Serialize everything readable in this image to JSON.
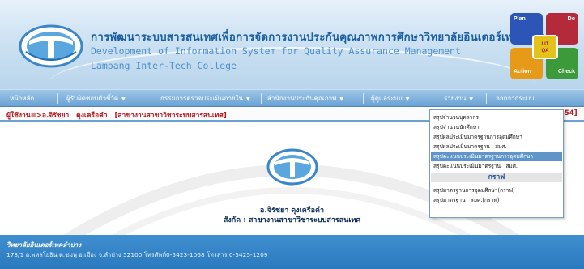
{
  "header": {
    "title_th": "การพัฒนาระบบสารสนเทศเพื่อการจัดการงานประกันคุณภาพการศึกษาวิทยาลัยอินเตอร์เทคลำปาง",
    "title_en": "Development of Information System for Quality Assurance Management",
    "college_en": "Lampang Inter-Tech College",
    "pdca": {
      "plan": "Plan",
      "do": "Do",
      "action": "Action",
      "check": "Check",
      "center_top": "LIT",
      "center_bottom": "QA"
    }
  },
  "menu": [
    {
      "label": "หน้าหลัก",
      "has_arrow": false
    },
    {
      "label": "ผู้รับผิดชอบตัวชี้วัด",
      "has_arrow": true
    },
    {
      "label": "กรรมการตรวจประเมินภายใน",
      "has_arrow": true
    },
    {
      "label": "สำนักงานประกันคุณภาพ",
      "has_arrow": true
    },
    {
      "label": "ผู้ดูแลระบบ",
      "has_arrow": true
    },
    {
      "label": "รายงาน",
      "has_arrow": true
    },
    {
      "label": "ออกจากระบบ",
      "has_arrow": false
    }
  ],
  "user_line": {
    "prefix": "ผู้ใช้งาน=>",
    "name": "อ.จิรัชยา   ดุงเครือคำ",
    "department": "[สาขางานสาขาวิชาระบบสารสนเทศ]",
    "right_code": "554]"
  },
  "dropdown": {
    "items": [
      "สรุปจำนวนบุคลากร",
      "สรุปจำนวนนักศึกษา",
      "สรุปผลประเมินมาตรฐานการอุดมศึกษา",
      "สรุปผลประเมินมาตรฐาน   สมศ.",
      "สรุปคะแนนประเมินมาตรฐานการอุดมศึกษา",
      "สรุปคะแนนประเมินมาตรฐาน   สมศ."
    ],
    "active_index": 4,
    "section_header": "กราฟ",
    "graph_items": [
      "สรุปมาตรฐานการอุดมศึกษา(กราฟ)",
      "สรุปมาตรฐาน   สมศ.(กราฟ)"
    ]
  },
  "content": {
    "teacher_name": "อ.จิรัชยา ดุงเครือคำ",
    "affiliation": "สังกัด : สาขางานสาขาวิชาระบบสารสนเทศ"
  },
  "footer": {
    "college": "วิทยาลัยอินเตอร์เทคลำปาง",
    "address": "173/1 ถ.พหลโยธิน ต.ชมพู อ.เมือง จ.ลำปาง 52100 โทรศัพท์0-5423-1068 โทรสาร 0-5425-1209"
  },
  "colors": {
    "header_title": "#1a5fa0",
    "menubar": "#6aa2d3",
    "user_line_text": "#b3151b",
    "dropdown_active": "#5f95c9",
    "footer": "#2b79be"
  },
  "icons": {
    "header_logo": "lit-logo-icon",
    "center_logo": "lit-logo-icon",
    "menu_arrow": "chevron-down-icon"
  }
}
